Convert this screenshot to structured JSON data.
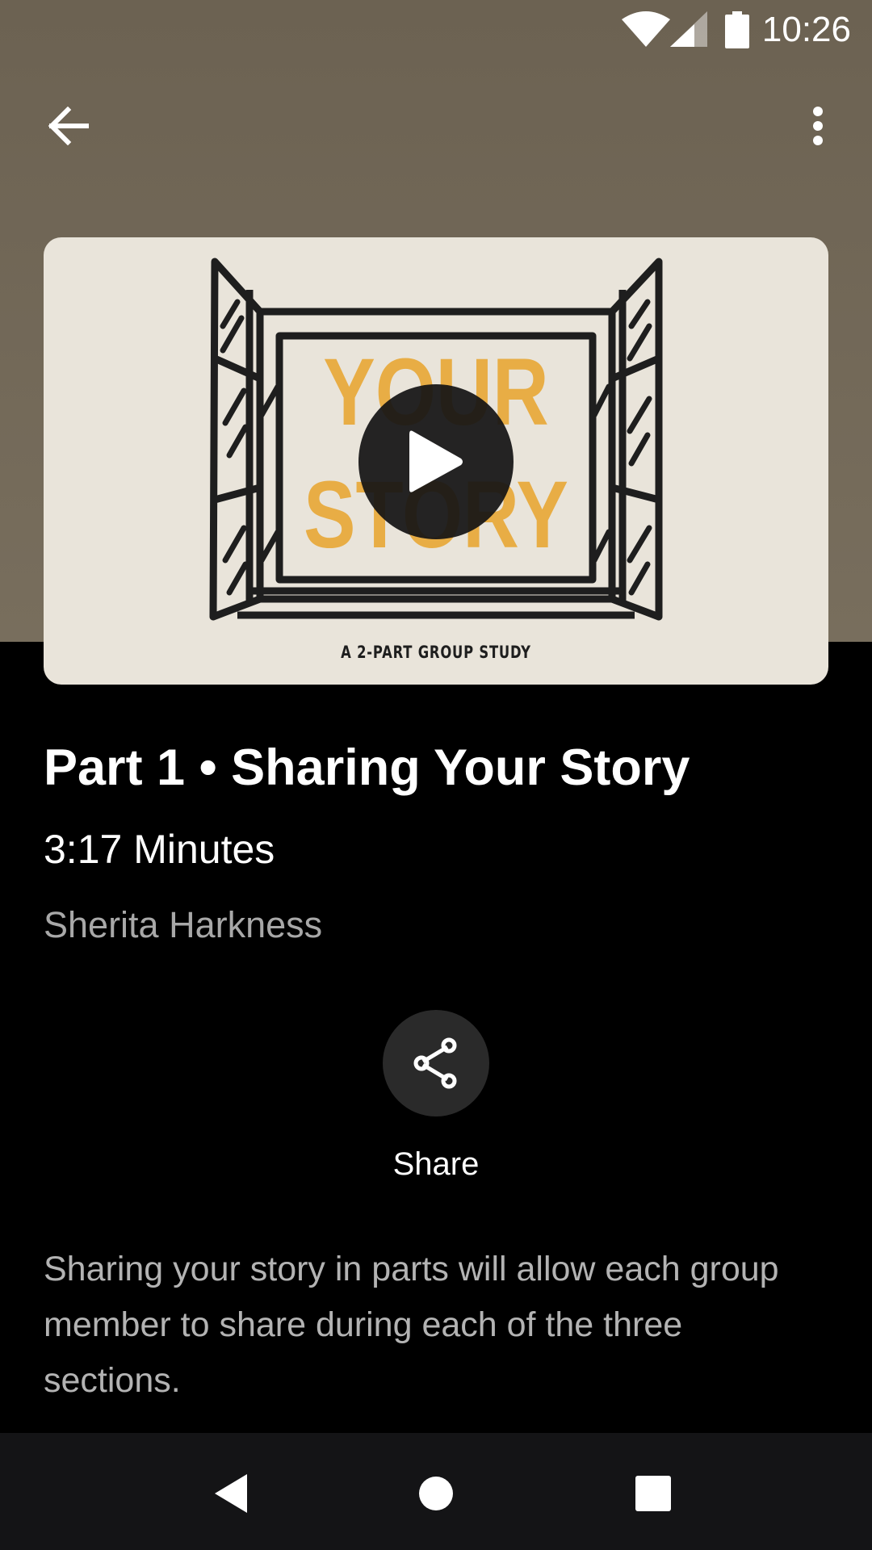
{
  "status_bar": {
    "time": "10:26",
    "icons": [
      "wifi-icon",
      "cell-signal-icon",
      "battery-icon"
    ]
  },
  "toolbar": {
    "back_icon": "arrow-left-icon",
    "more_icon": "more-vertical-icon"
  },
  "video": {
    "art_title_line1": "YOUR",
    "art_title_line2": "STORY",
    "art_caption": "A 2-PART GROUP STUDY",
    "play_icon": "play-icon"
  },
  "episode": {
    "title": "Part 1 • Sharing Your Story",
    "duration": "3:17 Minutes",
    "author": "Sherita Harkness"
  },
  "actions": {
    "share_label": "Share",
    "share_icon": "share-icon"
  },
  "description": "Sharing your story in parts will allow each group member to share during each of the three sections.",
  "colors": {
    "header_bg": "#6c6252",
    "art_accent": "#e8ad45",
    "page_bg": "#000000",
    "nav_bg": "#141416"
  }
}
